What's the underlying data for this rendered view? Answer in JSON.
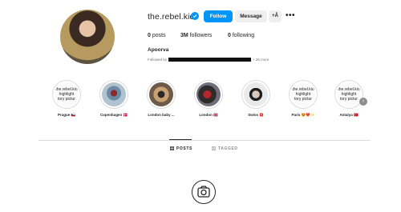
{
  "profile": {
    "username": "the.rebel.kid",
    "full_name": "Apoorva",
    "followed_by_prefix": "Followed by",
    "followed_by_suffix": "+ 26 more"
  },
  "actions": {
    "follow_label": "Follow",
    "message_label": "Message",
    "add_label": "+Å",
    "more_label": "•••"
  },
  "stats": {
    "posts_value": "0",
    "posts_label": "posts",
    "followers_value": "3M",
    "followers_label": "followers",
    "following_value": "0",
    "following_label": "following"
  },
  "highlights": [
    {
      "label": "Prague 🇨🇿",
      "caption": [
        "the.rebel.kio",
        "highlight",
        "tory pictur"
      ]
    },
    {
      "label": "Copenhagen 🇩🇰",
      "caption": []
    },
    {
      "label": "London baby ...",
      "caption": []
    },
    {
      "label": "London 🇬🇧",
      "caption": []
    },
    {
      "label": "Swiss 🇨🇭",
      "caption": []
    },
    {
      "label": "Paris 😍❤️✨",
      "caption": [
        "the.rebel.kio",
        "highlight",
        "tory pictur"
      ]
    },
    {
      "label": "Antalya 🇹🇷",
      "caption": [
        "the.rebel.kio",
        "highlight",
        "tory pictur"
      ]
    }
  ],
  "tabs": {
    "posts": "POSTS",
    "tagged": "TAGGED"
  },
  "colors": {
    "accent": "#0095f6",
    "button_gray": "#efefef",
    "text": "#262626",
    "muted": "#8e8e8e"
  },
  "icons": {
    "verified": "verified-badge-icon",
    "next": "chevron-right-icon",
    "posts_tab": "grid-icon",
    "tagged_tab": "tag-icon",
    "empty": "camera-icon"
  }
}
